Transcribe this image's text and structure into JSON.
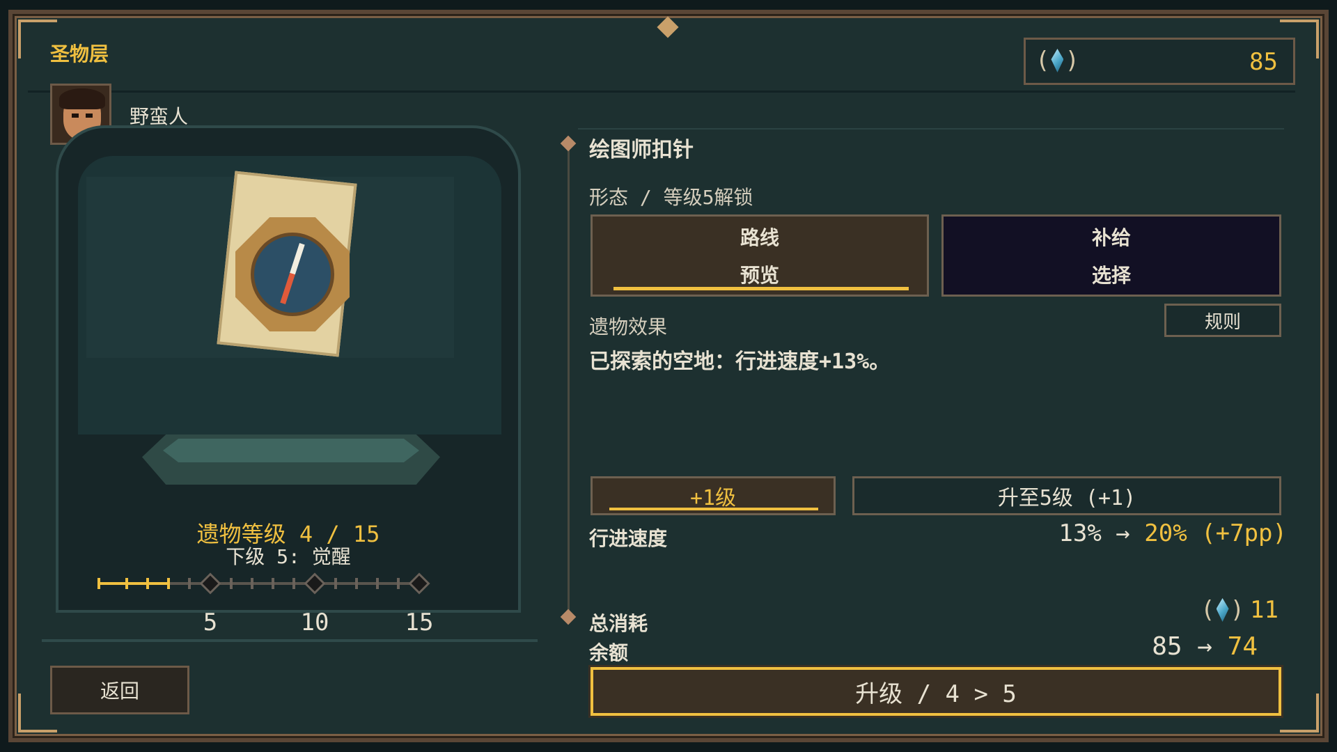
{
  "screen": {
    "title": "圣物层",
    "currency": {
      "icon": "crystal-icon",
      "value": "85"
    }
  },
  "character": {
    "name": "野蛮人",
    "avatar": "barbarian-portrait"
  },
  "relic_display": {
    "level_text": "遗物等级 4 / 15",
    "next_level_text": "下级 5: 觉醒",
    "level_track": {
      "current": 4,
      "max": 15,
      "milestones": [
        "5",
        "10",
        "15"
      ]
    }
  },
  "details": {
    "relic_name": "绘图师扣针",
    "form_line": "形态 / 等级5解锁",
    "options": [
      {
        "title": "路线",
        "subtitle": "预览"
      },
      {
        "title": "补给",
        "subtitle": "选择"
      }
    ],
    "effect_title": "遗物效果",
    "rules_label": "规则",
    "effect_desc": "已探索的空地：行进速度+13%。",
    "plus_label": "+1级",
    "upto_label": "升至5级 (+1)",
    "stat": {
      "label": "行进速度",
      "from": "13%",
      "arrow": "→",
      "to": "20%",
      "delta": "(+7pp)"
    },
    "total_label": "总消耗",
    "total_cost": "11",
    "remain_label": "余额",
    "remain": {
      "from": "85",
      "arrow": "→",
      "to": "74"
    },
    "upgrade_label": "升级 / 4 > 5"
  },
  "back_label": "返回",
  "colors": {
    "accent": "#f0c040",
    "panel": "#1d3030",
    "frame": "#5a4636"
  }
}
